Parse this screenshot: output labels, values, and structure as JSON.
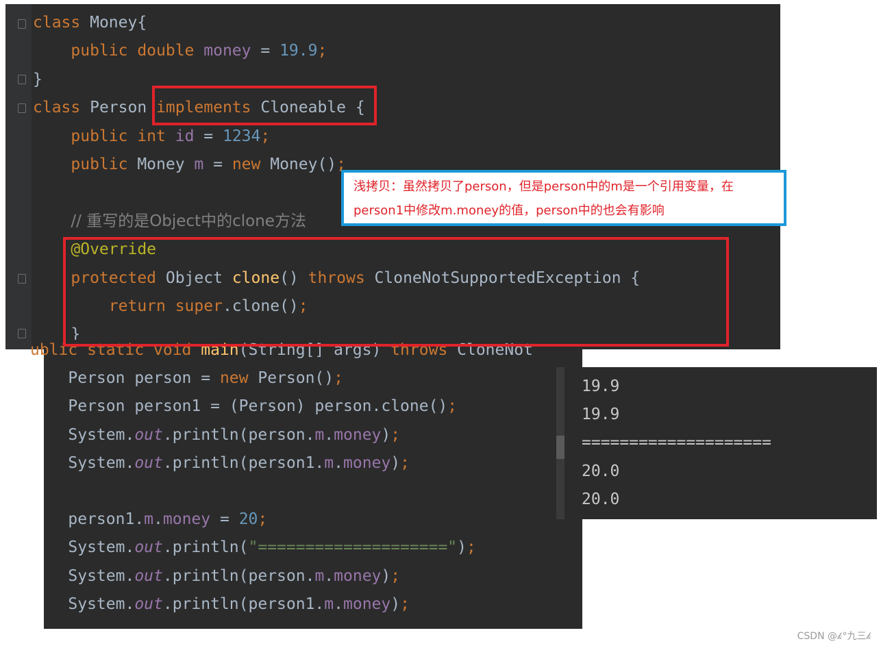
{
  "top_code": {
    "lines": [
      [
        [
          "kw",
          "class "
        ],
        [
          "p",
          "Money{"
        ]
      ],
      [
        [
          "p",
          "    "
        ],
        [
          "kw",
          "public double "
        ],
        [
          "fld",
          "money"
        ],
        [
          "p",
          " = "
        ],
        [
          "num",
          "19.9"
        ],
        [
          "kw",
          ";"
        ]
      ],
      [
        [
          "p",
          "}"
        ]
      ],
      [
        [
          "kw",
          "class "
        ],
        [
          "p",
          "Person "
        ],
        [
          "kw",
          "implements "
        ],
        [
          "p",
          "Cloneable {"
        ]
      ],
      [
        [
          "p",
          "    "
        ],
        [
          "kw",
          "public int "
        ],
        [
          "fld",
          "id"
        ],
        [
          "p",
          " = "
        ],
        [
          "num",
          "1234"
        ],
        [
          "kw",
          ";"
        ]
      ],
      [
        [
          "p",
          "    "
        ],
        [
          "kw",
          "public "
        ],
        [
          "p",
          "Money "
        ],
        [
          "fld",
          "m"
        ],
        [
          "p",
          " = "
        ],
        [
          "kw",
          "new "
        ],
        [
          "p",
          "Money()"
        ],
        [
          "kw",
          ";"
        ]
      ],
      [
        [
          "p",
          ""
        ]
      ],
      [
        [
          "p",
          "    "
        ],
        [
          "cmt",
          "// 重写的是Object中的clone方法"
        ]
      ],
      [
        [
          "p",
          "    "
        ],
        [
          "ann",
          "@Override"
        ]
      ],
      [
        [
          "p",
          "    "
        ],
        [
          "kw",
          "protected "
        ],
        [
          "p",
          "Object "
        ],
        [
          "fn",
          "clone"
        ],
        [
          "p",
          "() "
        ],
        [
          "kw",
          "throws "
        ],
        [
          "p",
          "CloneNotSupportedException {"
        ]
      ],
      [
        [
          "p",
          "        "
        ],
        [
          "kw",
          "return super"
        ],
        [
          "p",
          ".clone()"
        ],
        [
          "kw",
          ";"
        ]
      ],
      [
        [
          "p",
          "    }"
        ]
      ]
    ]
  },
  "main_code": {
    "lines": [
      [
        [
          "kw",
          "ublic static void "
        ],
        [
          "fn",
          "main"
        ],
        [
          "p",
          "(String[] args) "
        ],
        [
          "kw",
          "throws "
        ],
        [
          "p",
          "CloneNot"
        ]
      ],
      [
        [
          "p",
          "    Person person = "
        ],
        [
          "kw",
          "new "
        ],
        [
          "p",
          "Person()"
        ],
        [
          "kw",
          ";"
        ]
      ],
      [
        [
          "p",
          "    Person person1 = (Person) person.clone()"
        ],
        [
          "kw",
          ";"
        ]
      ],
      [
        [
          "p",
          "    System."
        ],
        [
          "it",
          "out"
        ],
        [
          "p",
          ".println(person."
        ],
        [
          "fld",
          "m"
        ],
        [
          "p",
          "."
        ],
        [
          "fld",
          "money"
        ],
        [
          "p",
          ")"
        ],
        [
          "kw",
          ";"
        ]
      ],
      [
        [
          "p",
          "    System."
        ],
        [
          "it",
          "out"
        ],
        [
          "p",
          ".println(person1."
        ],
        [
          "fld",
          "m"
        ],
        [
          "p",
          "."
        ],
        [
          "fld",
          "money"
        ],
        [
          "p",
          ")"
        ],
        [
          "kw",
          ";"
        ]
      ],
      [
        [
          "p",
          ""
        ]
      ],
      [
        [
          "p",
          "    person1."
        ],
        [
          "fld",
          "m"
        ],
        [
          "p",
          "."
        ],
        [
          "fld",
          "money"
        ],
        [
          "p",
          " = "
        ],
        [
          "num",
          "20"
        ],
        [
          "kw",
          ";"
        ]
      ],
      [
        [
          "p",
          "    System."
        ],
        [
          "it",
          "out"
        ],
        [
          "p",
          ".println("
        ],
        [
          "str",
          "\"====================\""
        ],
        [
          "p",
          ")"
        ],
        [
          "kw",
          ";"
        ]
      ],
      [
        [
          "p",
          "    System."
        ],
        [
          "it",
          "out"
        ],
        [
          "p",
          ".println(person."
        ],
        [
          "fld",
          "m"
        ],
        [
          "p",
          "."
        ],
        [
          "fld",
          "money"
        ],
        [
          "p",
          ")"
        ],
        [
          "kw",
          ";"
        ]
      ],
      [
        [
          "p",
          "    System."
        ],
        [
          "it",
          "out"
        ],
        [
          "p",
          ".println(person1."
        ],
        [
          "fld",
          "m"
        ],
        [
          "p",
          "."
        ],
        [
          "fld",
          "money"
        ],
        [
          "p",
          ")"
        ],
        [
          "kw",
          ";"
        ]
      ]
    ]
  },
  "console": {
    "lines": [
      "19.9",
      "19.9",
      "====================",
      "20.0",
      "20.0"
    ]
  },
  "annotation": {
    "line1": "浅拷贝：虽然拷贝了person，但是person中的m是一个引用变量，在",
    "line2": "person1中修改m.money的值，person中的也会有影响"
  },
  "watermark": "CSDN @𝓀°九三𝓀",
  "colors": {
    "editor_bg": "#2b2b2b",
    "highlight_red": "#e0232a",
    "highlight_blue": "#1c98d8"
  }
}
